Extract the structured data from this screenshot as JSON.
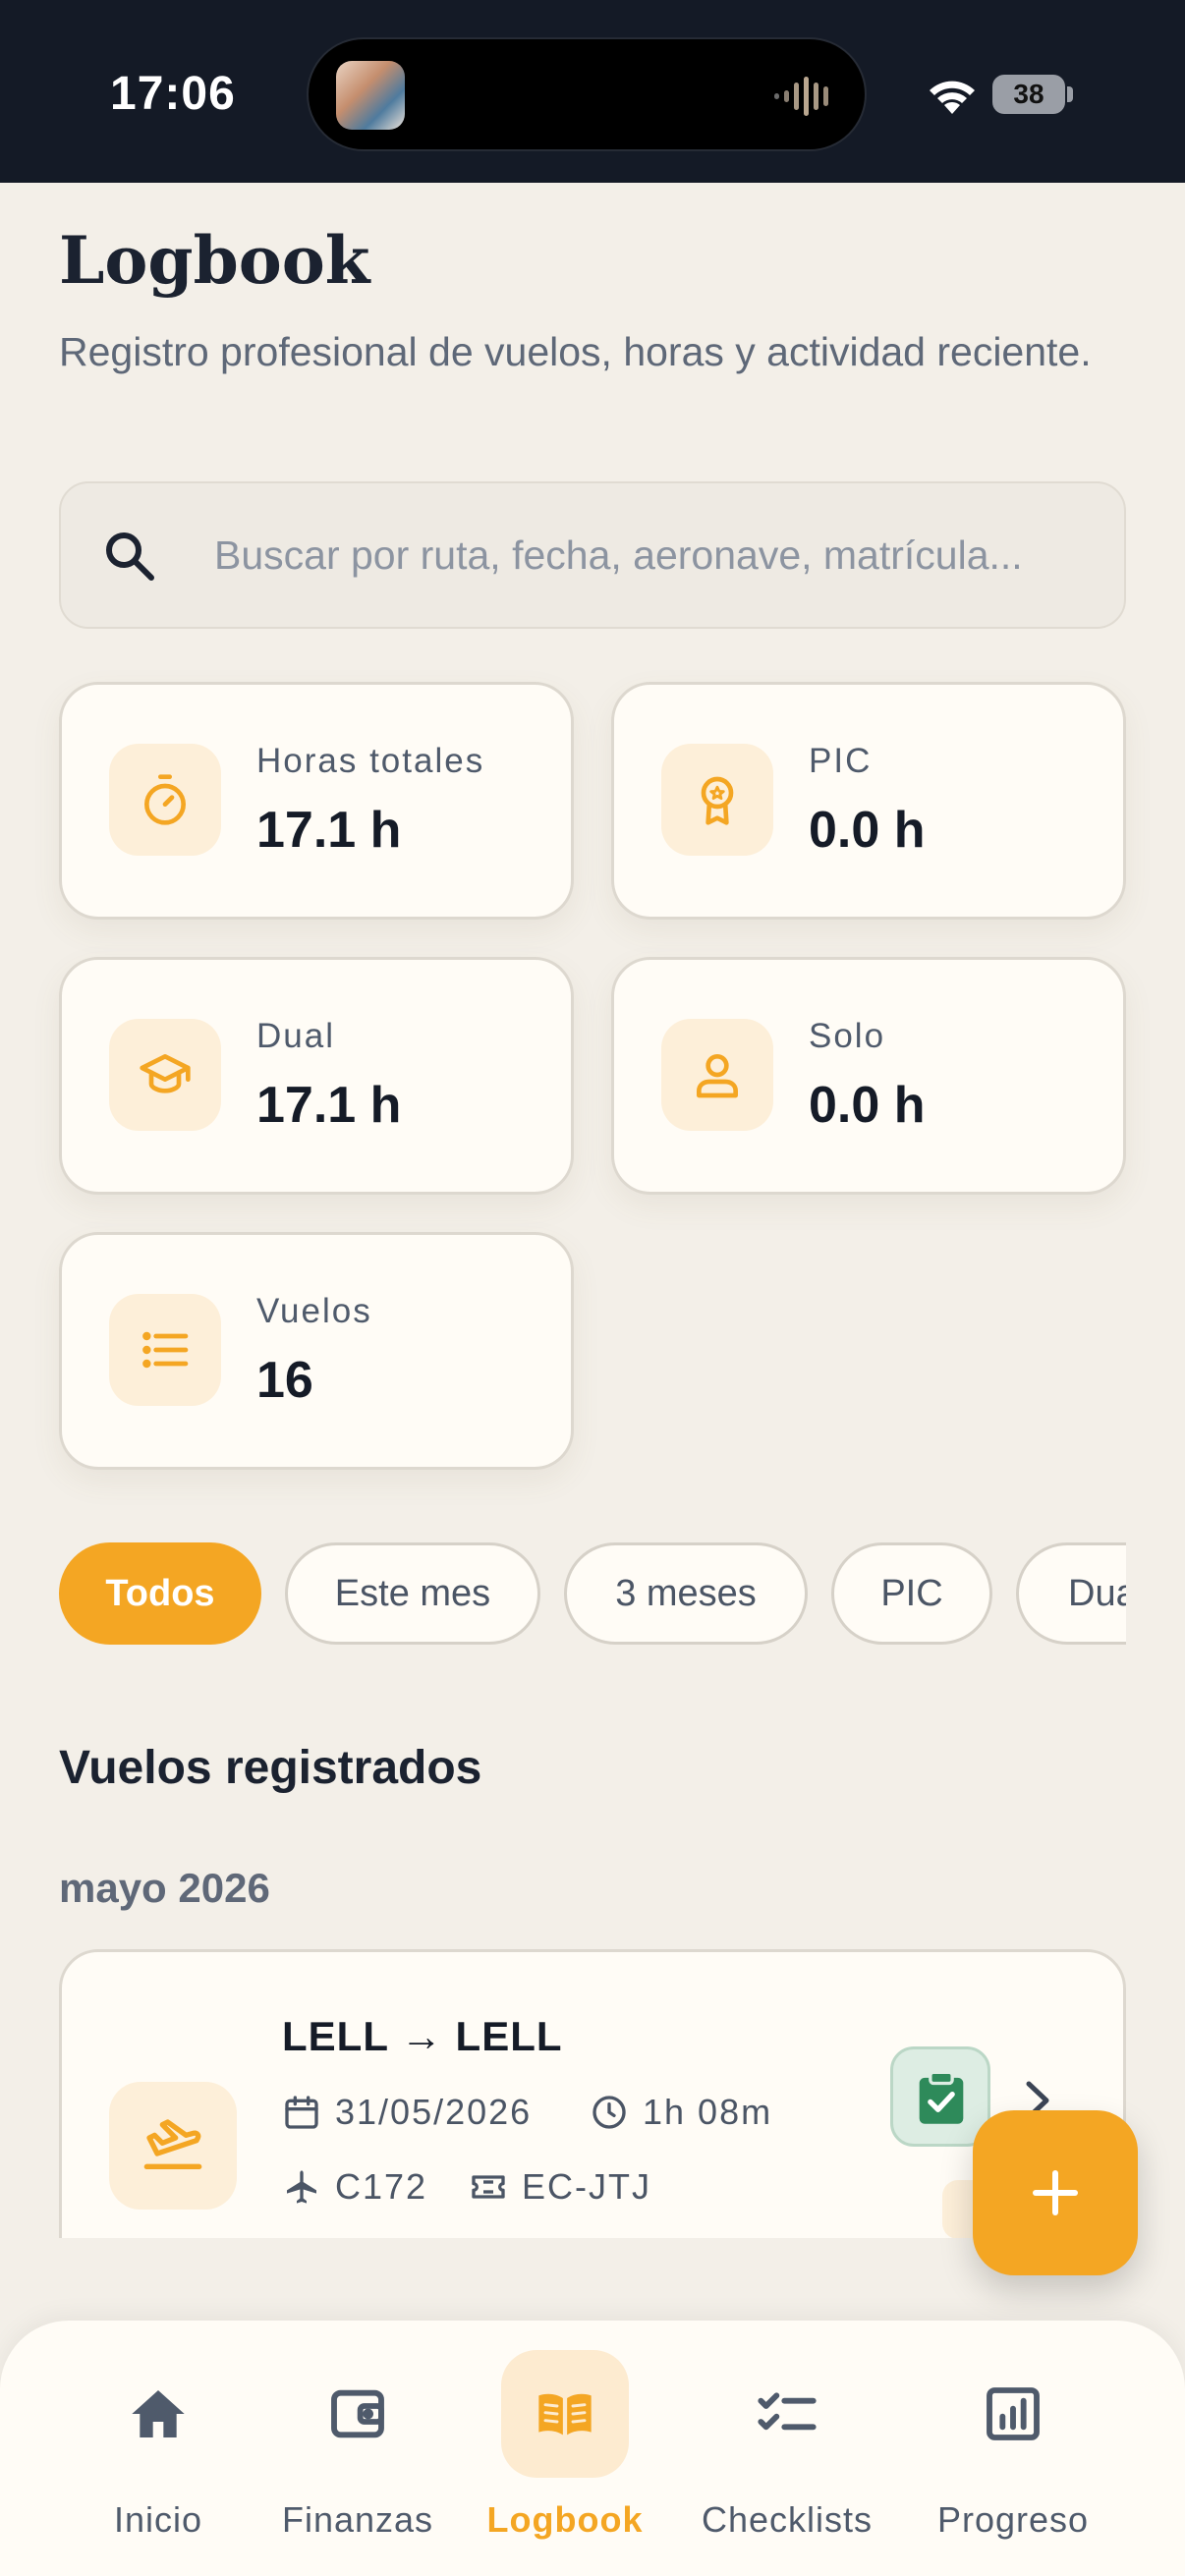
{
  "status_bar": {
    "time": "17:06",
    "battery": "38"
  },
  "header": {
    "title": "Logbook",
    "subtitle": "Registro profesional de vuelos, horas y actividad reciente."
  },
  "search": {
    "placeholder": "Buscar por ruta, fecha, aeronave, matrícula..."
  },
  "stats": [
    {
      "label": "Horas totales",
      "value": "17.1 h",
      "icon": "stopwatch-icon"
    },
    {
      "label": "PIC",
      "value": "0.0 h",
      "icon": "badge-icon"
    },
    {
      "label": "Dual",
      "value": "17.1 h",
      "icon": "graduation-cap-icon"
    },
    {
      "label": "Solo",
      "value": "0.0 h",
      "icon": "person-icon"
    },
    {
      "label": "Vuelos",
      "value": "16",
      "icon": "list-icon"
    }
  ],
  "filters": [
    {
      "label": "Todos",
      "active": true
    },
    {
      "label": "Este mes"
    },
    {
      "label": "3 meses"
    },
    {
      "label": "PIC"
    },
    {
      "label": "Dual"
    }
  ],
  "section": {
    "title": "Vuelos registrados"
  },
  "groups": [
    {
      "month": "mayo 2026",
      "flights": [
        {
          "route": "LELL → LELL",
          "date": "31/05/2026",
          "duration": "1h 08m",
          "aircraft": "C172",
          "registration": "EC-JTJ",
          "icon": "plane-landing-icon",
          "status": "clipboard-check-icon"
        }
      ]
    }
  ],
  "fab": {
    "icon": "plus-icon"
  },
  "nav": [
    {
      "label": "Inicio",
      "icon": "home-icon"
    },
    {
      "label": "Finanzas",
      "icon": "wallet-icon"
    },
    {
      "label": "Logbook",
      "icon": "book-open-icon",
      "active": true
    },
    {
      "label": "Checklists",
      "icon": "checklist-icon"
    },
    {
      "label": "Progreso",
      "icon": "bar-chart-icon"
    }
  ],
  "colors": {
    "accent": "#F4A623",
    "accent_soft": "#FDEFD9",
    "background": "#F3EFE8",
    "card": "#FFFCF6",
    "text": "#1B2230",
    "muted": "#5E6878",
    "success": "#2E8A5A",
    "status_bar": "#141A26"
  }
}
